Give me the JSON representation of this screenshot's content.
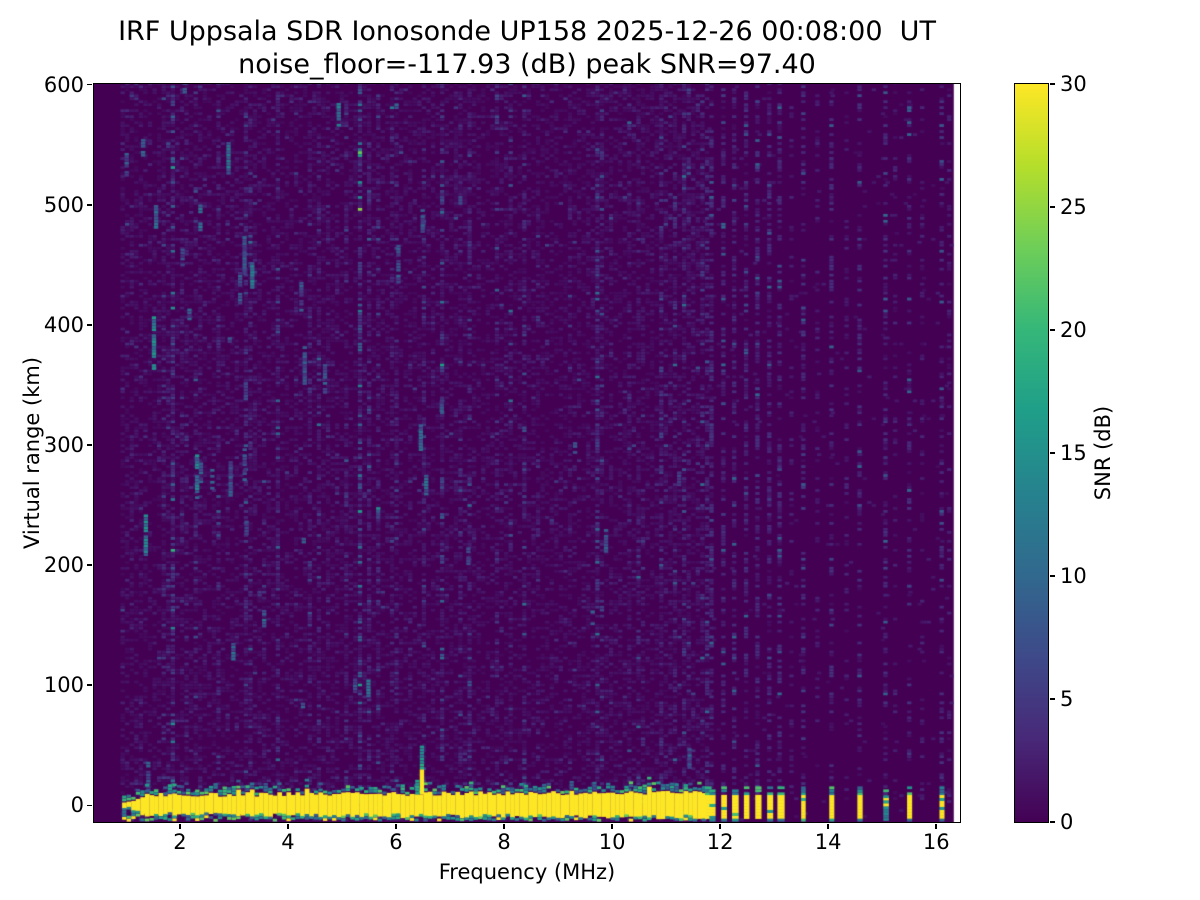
{
  "figure": {
    "title_line1": "IRF Uppsala SDR Ionosonde UP158 2025-12-26 00:08:00  UT",
    "title_line2": "noise_floor=-117.93 (dB) peak SNR=97.40",
    "background_color": "#ffffff"
  },
  "chart_data": {
    "type": "heatmap",
    "title": "IRF Uppsala SDR Ionosonde UP158 2025-12-26 00:08:00  UT",
    "subtitle": "noise_floor=-117.93 (dB) peak SNR=97.40",
    "xlabel": "Frequency (MHz)",
    "ylabel": "Virtual range (km)",
    "xlim": [
      0.41,
      16.44
    ],
    "ylim": [
      -13.9,
      600.5
    ],
    "xticks": [
      2,
      4,
      6,
      8,
      10,
      12,
      14,
      16
    ],
    "yticks": [
      0,
      100,
      200,
      300,
      400,
      500,
      600
    ],
    "grid": false,
    "colorbar": {
      "label": "SNR (dB)",
      "min": 0,
      "max": 30,
      "ticks": [
        0,
        5,
        10,
        15,
        20,
        25,
        30
      ],
      "colormap": "viridis",
      "position": "right"
    },
    "colors": {
      "background_low": "#440154",
      "peak_high": "#fde725",
      "no_data": "#ffffff",
      "viridis_stops": [
        "#440154",
        "#482878",
        "#3e4989",
        "#31688e",
        "#26828e",
        "#1f9e89",
        "#35b779",
        "#6ece58",
        "#b5de2b",
        "#fde725"
      ]
    },
    "features": {
      "noise_floor_db": -117.93,
      "peak_snr_db": 97.4,
      "data_freq_start_mhz": 0.9,
      "data_freq_end_mhz": 16.325,
      "white_gap_mhz": [
        16.325,
        16.44
      ],
      "ground_echo_band": {
        "range_km_center": 0,
        "half_width_km": 9.5,
        "freq_start_mhz": 0.93,
        "freq_end_mhz": 11.68,
        "snr_db": 30
      },
      "echo_spike": {
        "freq_mhz": 6.44,
        "top_km": 44,
        "snr_db": 30
      },
      "transmit_bar_freqs_mhz": [
        11.72,
        11.8,
        12.02,
        12.22,
        12.44,
        12.65,
        12.87,
        13.06,
        13.5,
        14.02,
        14.54,
        15.02,
        15.46,
        16.06
      ],
      "faint_bar_freqs_mhz": [
        15.02
      ],
      "extra_stripe_freqs_mhz": [
        13.28,
        13.76,
        14.3,
        15.2,
        15.7,
        16.2
      ],
      "bar_range_km": [
        -11,
        8.5
      ],
      "noise_streaks": [
        {
          "f": 1.28,
          "km": 540,
          "len": 14,
          "v0": 7,
          "vr": 6
        },
        {
          "f": 1.33,
          "km": 205,
          "len": 35,
          "v0": 8,
          "vr": 8
        },
        {
          "f": 1.48,
          "km": 360,
          "len": 45,
          "v0": 9,
          "vr": 8
        },
        {
          "f": 1.52,
          "km": 480,
          "len": 18,
          "v0": 7,
          "vr": 6
        },
        {
          "f": 2.05,
          "km": 590,
          "len": 10,
          "v0": 6,
          "vr": 5
        },
        {
          "f": 2.28,
          "km": 255,
          "len": 38,
          "v0": 8,
          "vr": 8
        },
        {
          "f": 2.34,
          "km": 478,
          "len": 20,
          "v0": 7,
          "vr": 6
        },
        {
          "f": 2.86,
          "km": 525,
          "len": 26,
          "v0": 7,
          "vr": 7
        },
        {
          "f": 2.95,
          "km": 118,
          "len": 16,
          "v0": 6,
          "vr": 6
        },
        {
          "f": 3.3,
          "km": 430,
          "len": 22,
          "v0": 7,
          "vr": 7
        },
        {
          "f": 3.52,
          "km": 148,
          "len": 14,
          "v0": 6,
          "vr": 6
        },
        {
          "f": 4.27,
          "km": 350,
          "len": 30,
          "v0": 5,
          "vr": 5
        },
        {
          "f": 4.9,
          "km": 565,
          "len": 18,
          "v0": 7,
          "vr": 7
        },
        {
          "f": 5.45,
          "km": 90,
          "len": 14,
          "v0": 6,
          "vr": 6
        },
        {
          "f": 6.42,
          "km": 295,
          "len": 22,
          "v0": 6,
          "vr": 6
        },
        {
          "f": 6.52,
          "km": 258,
          "len": 16,
          "v0": 6,
          "vr": 6
        },
        {
          "f": 7.3,
          "km": 200,
          "len": 14,
          "v0": 5,
          "vr": 5
        },
        {
          "f": 9.6,
          "km": 150,
          "len": 12,
          "v0": 5,
          "vr": 5
        }
      ]
    }
  }
}
